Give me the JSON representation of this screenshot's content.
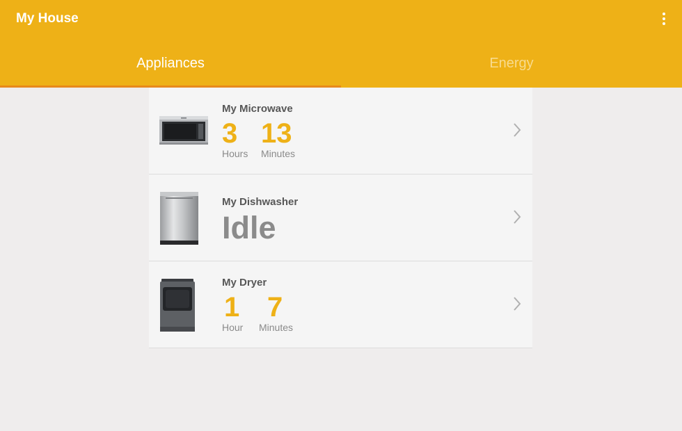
{
  "app": {
    "title": "My House"
  },
  "tabs": [
    {
      "label": "Appliances",
      "selected": true
    },
    {
      "label": "Energy",
      "selected": false
    }
  ],
  "colors": {
    "accent": "#eeb117",
    "tab_indicator": "#e8891c",
    "background": "#efeded",
    "card": "#f5f5f5"
  },
  "appliances": [
    {
      "name": "My Microwave",
      "icon": "microwave-image",
      "time": {
        "hours": "3",
        "hours_label": "Hours",
        "minutes": "13",
        "minutes_label": "Minutes"
      }
    },
    {
      "name": "My Dishwasher",
      "icon": "dishwasher-image",
      "status": "Idle"
    },
    {
      "name": "My Dryer",
      "icon": "dryer-image",
      "time": {
        "hours": "1",
        "hours_label": "Hour",
        "minutes": "7",
        "minutes_label": "Minutes"
      }
    }
  ]
}
